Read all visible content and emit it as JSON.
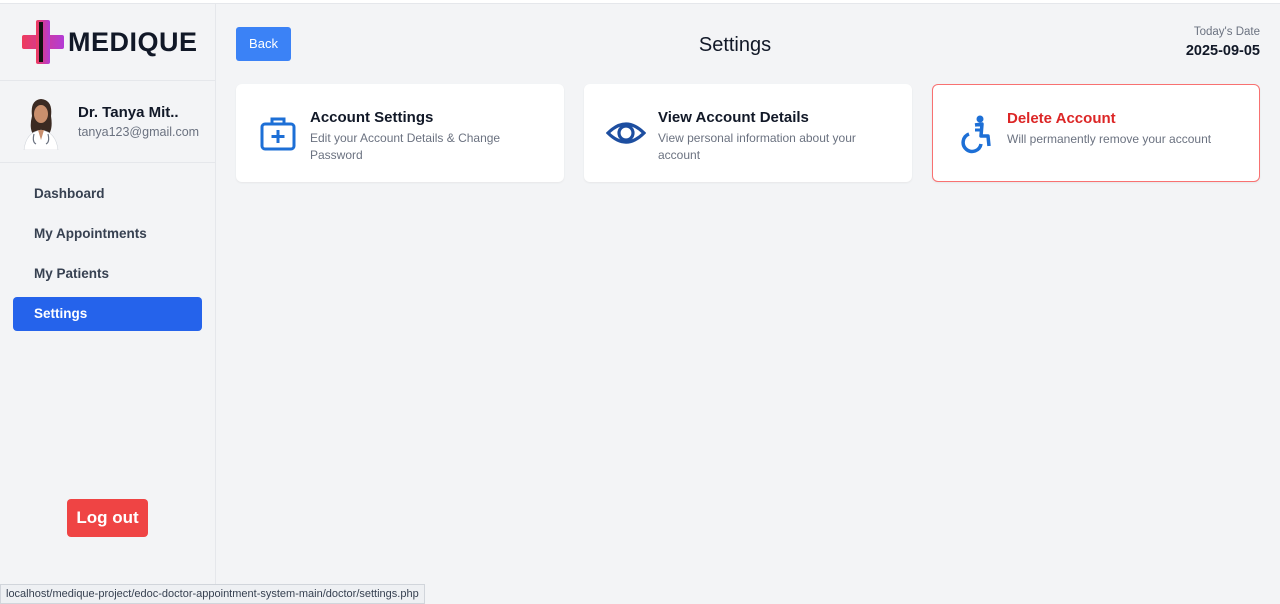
{
  "brand": {
    "name": "MEDIQUE"
  },
  "profile": {
    "name": "Dr. Tanya Mit..",
    "email": "tanya123@gmail.com"
  },
  "nav": {
    "items": [
      {
        "label": "Dashboard"
      },
      {
        "label": "My Appointments"
      },
      {
        "label": "My Patients"
      },
      {
        "label": "Settings",
        "active": true
      }
    ]
  },
  "logout_label": "Log out",
  "header": {
    "back_label": "Back",
    "title": "Settings",
    "date_label": "Today's Date",
    "date_value": "2025-09-05"
  },
  "cards": [
    {
      "icon": "medical-kit-icon",
      "title": "Account Settings",
      "desc": "Edit your Account Details & Change Password"
    },
    {
      "icon": "eye-icon",
      "title": "View Account Details",
      "desc": "View personal information about your account"
    },
    {
      "icon": "wheelchair-icon",
      "title": "Delete Account",
      "desc": "Will permanently remove your account"
    }
  ],
  "status_bar": {
    "url": "localhost/medique-project/edoc-doctor-appointment-system-main/doctor/settings.php"
  },
  "colors": {
    "primary": "#2563eb",
    "back_button": "#3b82f6",
    "danger": "#dc2626",
    "logout": "#ef4444",
    "icon_blue": "#1d6fd6"
  }
}
